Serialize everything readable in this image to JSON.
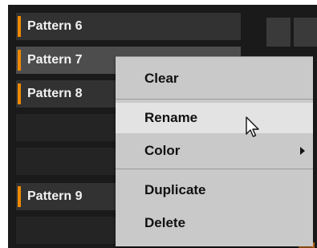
{
  "patterns": [
    {
      "label": "Pattern 6",
      "state": "filled"
    },
    {
      "label": "Pattern 7",
      "state": "selected"
    },
    {
      "label": "Pattern 8",
      "state": "filled"
    },
    {
      "label": "",
      "state": "empty"
    },
    {
      "label": "",
      "state": "empty"
    },
    {
      "label": "Pattern 9",
      "state": "filled"
    },
    {
      "label": "",
      "state": "empty"
    }
  ],
  "accent_color": "#f08a00",
  "context_menu": {
    "items": [
      {
        "label": "Clear"
      },
      {
        "label": "Rename",
        "hovered": true
      },
      {
        "label": "Color",
        "has_submenu": true
      },
      {
        "label": "Duplicate"
      },
      {
        "label": "Delete"
      }
    ]
  },
  "icons": {
    "cursor": "arrow-pointer-icon",
    "submenu": "triangle-right-icon"
  }
}
